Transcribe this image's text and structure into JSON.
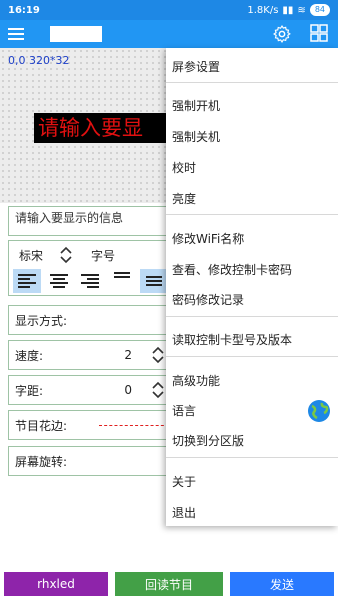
{
  "statusbar": {
    "time": "16:19",
    "net_speed": "1.8K/s",
    "battery": "84"
  },
  "preview": {
    "coords": "0,0 320*32",
    "led_text": "请输入要显"
  },
  "form": {
    "input_placeholder": "请输入要显示的信息",
    "font_name": "标宋",
    "font_size_label": "字号",
    "display_mode_label": "显示方式:",
    "speed_label": "速度:",
    "speed_value": "2",
    "spacing_label": "字距:",
    "spacing_value": "0",
    "border_label": "节目花边:",
    "rotate_label": "屏幕旋转:"
  },
  "menu": {
    "items": [
      "屏参设置",
      "强制开机",
      "强制关机",
      "校时",
      "亮度",
      "修改WiFi名称",
      "查看、修改控制卡密码",
      "密码修改记录",
      "读取控制卡型号及版本",
      "高级功能",
      "语言",
      "切换到分区版",
      "关于",
      "退出"
    ]
  },
  "bottom": {
    "left_label": "rhxled",
    "middle_label": "回读节目",
    "right_label": "发送"
  },
  "colors": {
    "appbar": "#2196f3",
    "led_text": "#e01010",
    "purple": "#8e24aa",
    "green": "#43a047",
    "blue": "#2979ff"
  }
}
